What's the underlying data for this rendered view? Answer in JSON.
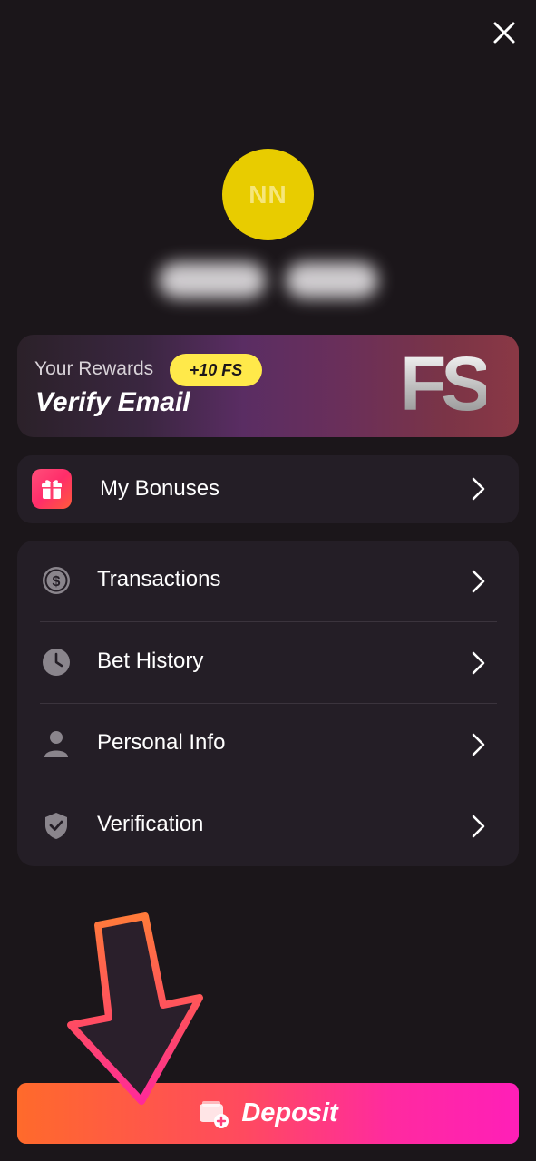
{
  "header": {
    "close_icon": "close-icon"
  },
  "profile": {
    "initials": "NN",
    "avatar_color": "#e8cc00"
  },
  "rewards": {
    "label": "Your Rewards",
    "badge": "+10 FS",
    "title": "Verify Email",
    "logo_text": "FS",
    "badge_color": "#ffe94a"
  },
  "bonuses": {
    "label": "My Bonuses",
    "icon": "gift-icon"
  },
  "menu": {
    "items": [
      {
        "label": "Transactions",
        "icon": "dollar-coin-icon"
      },
      {
        "label": "Bet History",
        "icon": "clock-icon"
      },
      {
        "label": "Personal Info",
        "icon": "person-icon"
      },
      {
        "label": "Verification",
        "icon": "shield-check-icon"
      }
    ]
  },
  "deposit": {
    "label": "Deposit",
    "icon": "wallet-add-icon",
    "gradient": [
      "#ff6a2b",
      "#ff1fb8"
    ]
  },
  "colors": {
    "background": "#1b161a",
    "card": "#241e26",
    "arrow_stroke": "#ff5a6e"
  }
}
